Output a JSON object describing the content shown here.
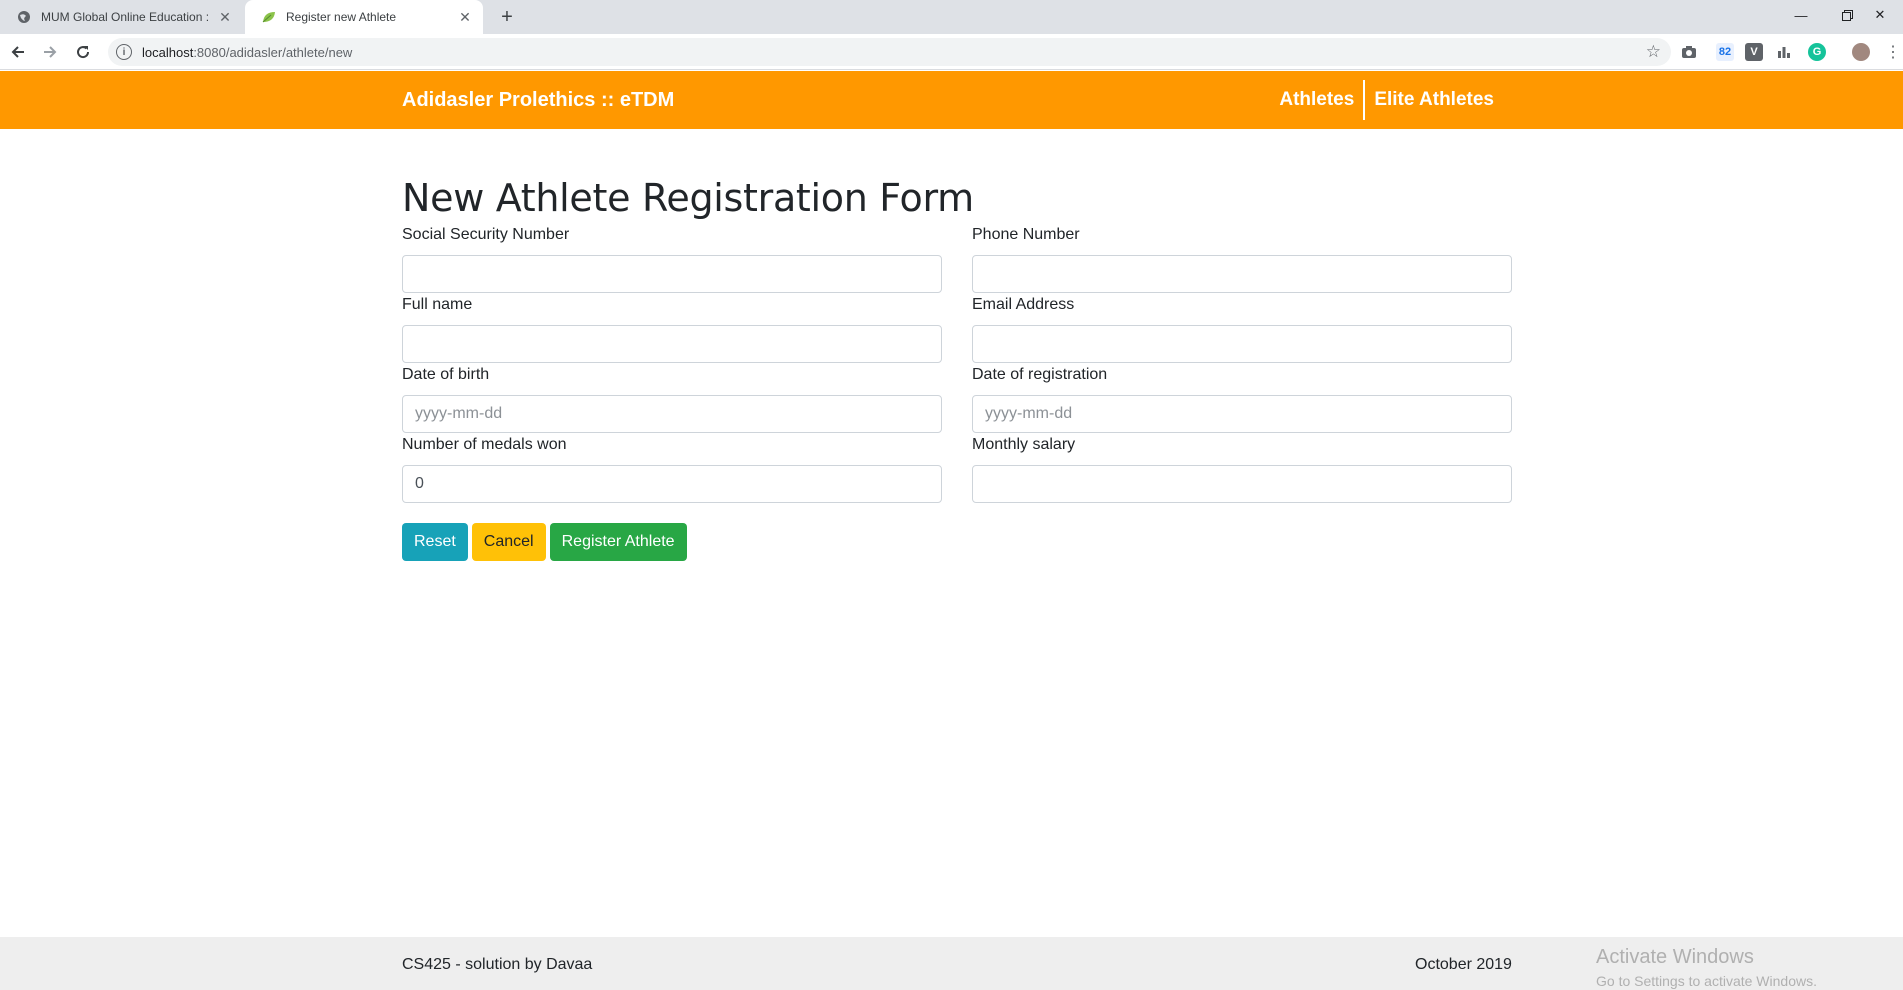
{
  "browser": {
    "tabs": [
      {
        "title": "MUM Global Online Education : C",
        "active": false,
        "icon": "globe-icon"
      },
      {
        "title": "Register new Athlete",
        "active": true,
        "icon": "leaf-icon"
      }
    ],
    "new_tab": "+",
    "url_host": "localhost",
    "url_rest": ":8080/adidasler/athlete/new",
    "extension_badge": "82"
  },
  "navbar": {
    "brand": "Adidasler Prolethics :: eTDM",
    "links": [
      "Athletes",
      "Elite Athletes"
    ],
    "color": "#ff9800"
  },
  "page": {
    "title": "New Athlete Registration Form"
  },
  "form": {
    "ssn": {
      "label": "Social Security Number",
      "value": "",
      "placeholder": ""
    },
    "phone": {
      "label": "Phone Number",
      "value": "",
      "placeholder": ""
    },
    "fullname": {
      "label": "Full name",
      "value": "",
      "placeholder": ""
    },
    "email": {
      "label": "Email Address",
      "value": "",
      "placeholder": ""
    },
    "dob": {
      "label": "Date of birth",
      "value": "",
      "placeholder": "yyyy-mm-dd"
    },
    "dor": {
      "label": "Date of registration",
      "value": "",
      "placeholder": "yyyy-mm-dd"
    },
    "medals": {
      "label": "Number of medals won",
      "value": "0",
      "placeholder": ""
    },
    "salary": {
      "label": "Monthly salary",
      "value": "",
      "placeholder": ""
    }
  },
  "buttons": {
    "reset": "Reset",
    "cancel": "Cancel",
    "register": "Register Athlete"
  },
  "footer": {
    "left": "CS425 - solution by Davaa",
    "right": "October 2019"
  },
  "watermark": {
    "line1": "Activate Windows",
    "line2": "Go to Settings to activate Windows."
  }
}
